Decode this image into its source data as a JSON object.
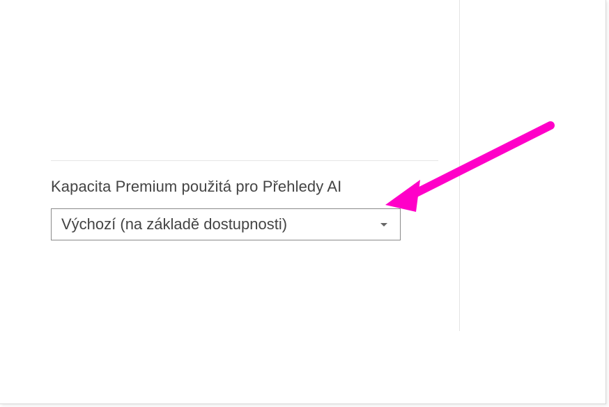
{
  "settings": {
    "capacity_label": "Kapacita Premium použitá pro Přehledy AI",
    "capacity_dropdown_value": "Výchozí (na základě dostupnosti)"
  },
  "annotation": {
    "arrow_color": "#ff00c8"
  }
}
